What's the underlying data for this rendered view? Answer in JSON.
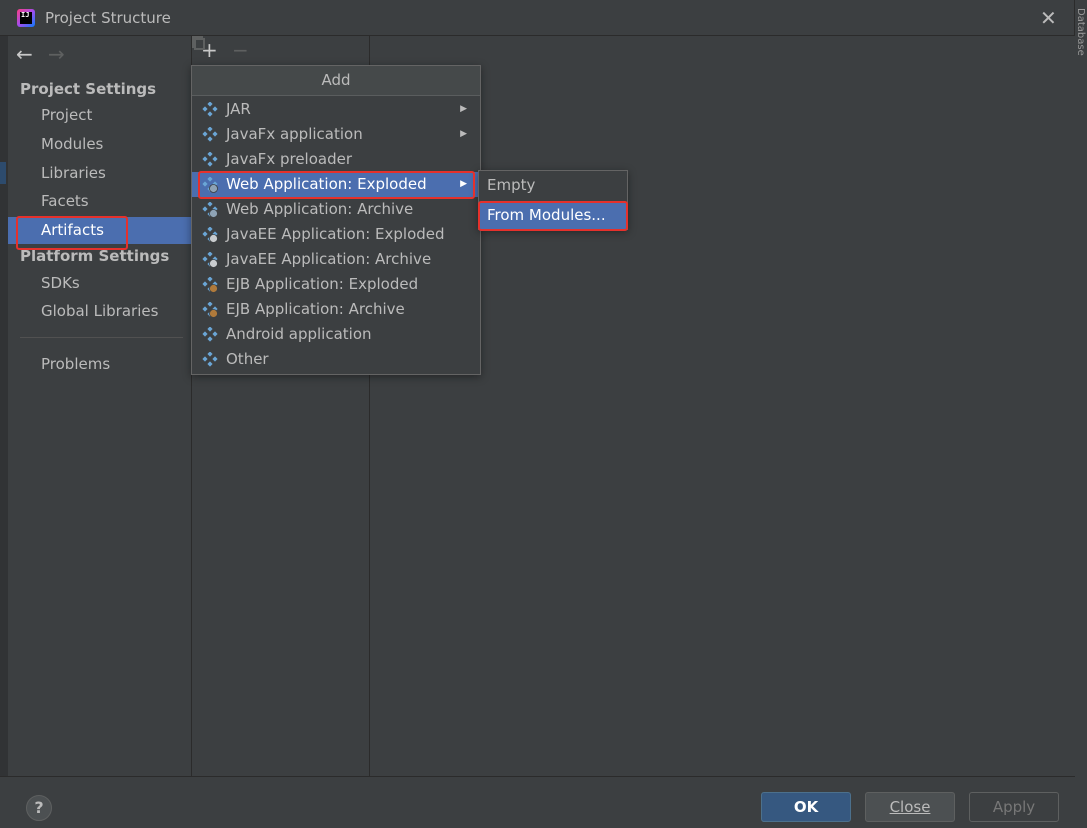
{
  "window": {
    "title": "Project Structure",
    "close_glyph": "✕",
    "side_tab": "Database"
  },
  "nav": {
    "back_glyph": "←",
    "forward_glyph": "→"
  },
  "sidebar": {
    "project_settings_header": "Project Settings",
    "project_items": [
      {
        "label": "Project"
      },
      {
        "label": "Modules"
      },
      {
        "label": "Libraries"
      },
      {
        "label": "Facets"
      },
      {
        "label": "Artifacts",
        "selected": true
      }
    ],
    "platform_settings_header": "Platform Settings",
    "platform_items": [
      {
        "label": "SDKs"
      },
      {
        "label": "Global Libraries"
      }
    ],
    "problems_label": "Problems"
  },
  "toolbar": {
    "add_glyph": "+",
    "remove_glyph": "−"
  },
  "add_popup": {
    "title": "Add",
    "items": [
      {
        "label": "JAR",
        "icon": "artifact-icon",
        "has_submenu": true
      },
      {
        "label": "JavaFx application",
        "icon": "artifact-icon",
        "has_submenu": true
      },
      {
        "label": "JavaFx preloader",
        "icon": "artifact-icon",
        "has_submenu": false
      },
      {
        "label": "Web Application: Exploded",
        "icon": "web-artifact-icon",
        "has_submenu": true,
        "selected": true
      },
      {
        "label": "Web Application: Archive",
        "icon": "web-artifact-icon",
        "has_submenu": false
      },
      {
        "label": "JavaEE Application: Exploded",
        "icon": "javaee-artifact-icon",
        "has_submenu": false
      },
      {
        "label": "JavaEE Application: Archive",
        "icon": "javaee-artifact-icon",
        "has_submenu": false
      },
      {
        "label": "EJB Application: Exploded",
        "icon": "ejb-artifact-icon",
        "has_submenu": false
      },
      {
        "label": "EJB Application: Archive",
        "icon": "ejb-artifact-icon",
        "has_submenu": false
      },
      {
        "label": "Android application",
        "icon": "artifact-icon",
        "has_submenu": false
      },
      {
        "label": "Other",
        "icon": "artifact-icon",
        "has_submenu": false
      }
    ],
    "submenu_arrow": "▶"
  },
  "submenu": {
    "items": [
      {
        "label": "Empty"
      },
      {
        "label": "From Modules...",
        "selected": true
      }
    ]
  },
  "footer": {
    "help_glyph": "?",
    "ok_label": "OK",
    "close_label": "Close",
    "apply_label": "Apply"
  },
  "colors": {
    "selection": "#4b6eaf",
    "highlight_border": "#e5312c",
    "ok_button": "#365880",
    "background": "#3c3f41"
  }
}
